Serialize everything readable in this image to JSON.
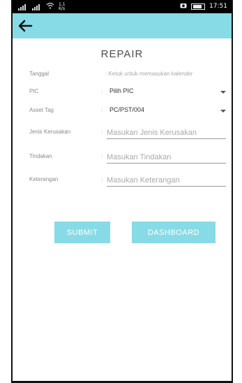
{
  "status_bar": {
    "network_speed": "1,1\nK/s",
    "battery_label": "88",
    "time": "17:51"
  },
  "app_bar": {
    "back_icon": "arrow-left-icon",
    "background": "#87dbe6"
  },
  "page": {
    "title": "REPAIR"
  },
  "form": {
    "tanggal": {
      "label": "Tanggal",
      "value": ": Ketuk untuk memasukan kalender"
    },
    "pic": {
      "label": "PIC",
      "colon": ":",
      "selected": "Pilih PIC"
    },
    "asset_tag": {
      "label": "Asset Tag",
      "colon": ":",
      "selected": "PC/PST/004"
    },
    "jenis_kerusakan": {
      "label": "Jenis Kerusakan",
      "colon": ":",
      "placeholder": "Masukan Jenis Kerusakan"
    },
    "tindakan": {
      "label": "Tindakan",
      "colon": ":",
      "placeholder": "Masukan Tindakan"
    },
    "keterangan": {
      "label": "Keterangan",
      "colon": ":",
      "placeholder": "Masukan Keterangan"
    }
  },
  "buttons": {
    "submit": "SUBMIT",
    "dashboard": "DASHBOARD"
  }
}
